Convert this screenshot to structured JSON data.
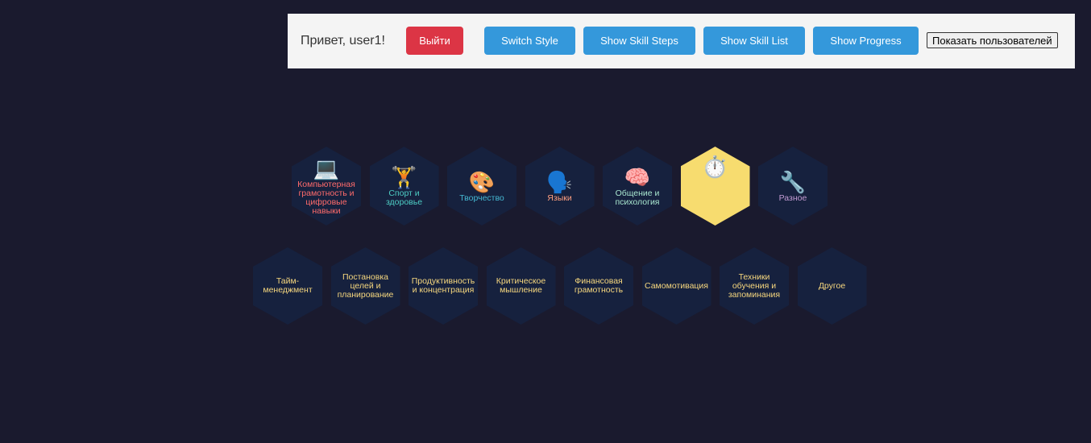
{
  "header": {
    "greeting": "Привет, user1!",
    "logout": "Выйти",
    "switch_style": "Switch Style",
    "skill_steps": "Show Skill Steps",
    "skill_list": "Show Skill List",
    "progress": "Show Progress",
    "show_users": "Показать пользователей",
    "colors": {
      "logout": "#dc3545",
      "primary": "#3498db"
    }
  },
  "categories": [
    {
      "icon": "laptop-icon",
      "glyph": "💻",
      "label": "Компьютерная грамотность и цифровые навыки",
      "color": "#ff6b6b"
    },
    {
      "icon": "weightlifter-icon",
      "glyph": "🏋️",
      "label": "Спорт и здоровье",
      "color": "#4ecdc4"
    },
    {
      "icon": "palette-icon",
      "glyph": "🎨",
      "label": "Творчество",
      "color": "#45b7d1"
    },
    {
      "icon": "speaking-head-icon",
      "glyph": "🗣️",
      "label": "Языки",
      "color": "#ff9f80"
    },
    {
      "icon": "brain-icon",
      "glyph": "🧠",
      "label": "Общение и психология",
      "color": "#a8e6cf"
    },
    {
      "icon": "stopwatch-icon",
      "glyph": "⏱️",
      "label": "",
      "color": "#333",
      "active": true
    },
    {
      "icon": "wrench-icon",
      "glyph": "🔧",
      "label": "Разное",
      "color": "#c39bd3"
    }
  ],
  "subcategories": [
    "Тайм-менеджмент",
    "Постановка целей и планирование",
    "Продуктивность и концентрация",
    "Критическое мышление",
    "Финансовая грамотность",
    "Самомотивация",
    "Техники обучения и запоминания",
    "Другое"
  ]
}
